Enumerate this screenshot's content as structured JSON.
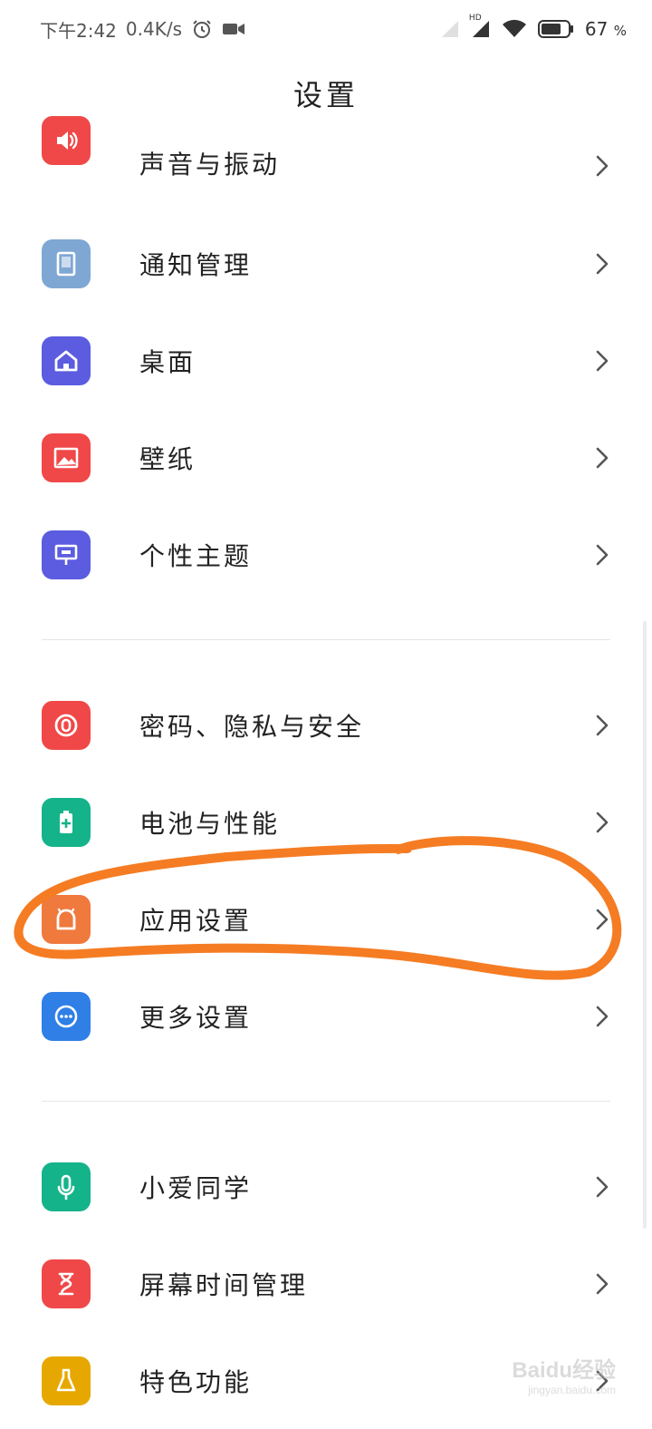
{
  "status_bar": {
    "time": "下午2:42",
    "network_speed": "0.4K/s",
    "battery_percent": "67",
    "battery_unit": "%",
    "hd_label": "HD"
  },
  "header": {
    "title": "设置"
  },
  "groups": [
    {
      "items": [
        {
          "label": "声音与振动",
          "icon": "speaker-icon",
          "color": "#f04848"
        },
        {
          "label": "通知管理",
          "icon": "notification-icon",
          "color": "#7fa7d4"
        },
        {
          "label": "桌面",
          "icon": "home-icon",
          "color": "#5b5ce0"
        },
        {
          "label": "壁纸",
          "icon": "wallpaper-icon",
          "color": "#f04848"
        },
        {
          "label": "个性主题",
          "icon": "theme-icon",
          "color": "#5b5ce0"
        }
      ]
    },
    {
      "items": [
        {
          "label": "密码、隐私与安全",
          "icon": "lock-icon",
          "color": "#f04848"
        },
        {
          "label": "电池与性能",
          "icon": "battery-icon",
          "color": "#15b38a"
        },
        {
          "label": "应用设置",
          "icon": "app-icon",
          "color": "#f0793e"
        },
        {
          "label": "更多设置",
          "icon": "more-icon",
          "color": "#2f7fe6"
        }
      ]
    },
    {
      "items": [
        {
          "label": "小爱同学",
          "icon": "microphone-icon",
          "color": "#15b38a"
        },
        {
          "label": "屏幕时间管理",
          "icon": "hourglass-icon",
          "color": "#f04848"
        },
        {
          "label": "特色功能",
          "icon": "feature-icon",
          "color": "#e6a800"
        }
      ]
    }
  ],
  "watermark": {
    "main": "Baidu经验",
    "sub": "jingyan.baidu.com"
  }
}
